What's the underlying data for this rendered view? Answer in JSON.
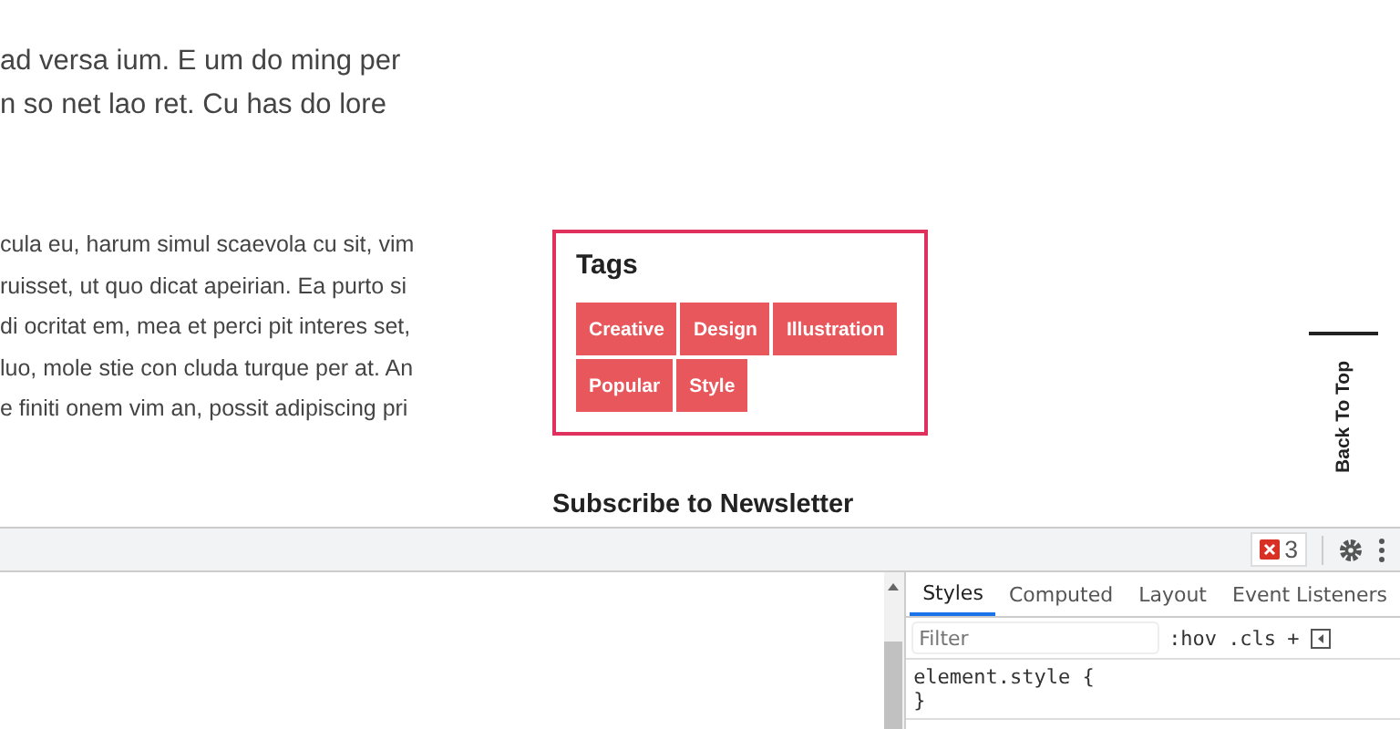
{
  "article": {
    "intro_lines": [
      "ad versa ium. E um do ming per",
      "n so net lao ret. Cu has do lore"
    ],
    "body_lines": [
      "cula eu, harum simul scaevola cu sit, vim",
      "ruisset, ut quo dicat apeirian. Ea purto si",
      "di ocritat em, mea et perci pit interes set,",
      "luo, mole stie con cluda turque per at. An",
      "e finiti onem vim an, possit adipiscing pri"
    ]
  },
  "tags_widget": {
    "title": "Tags",
    "tags": [
      "Creative",
      "Design",
      "Illustration",
      "Popular",
      "Style"
    ]
  },
  "newsletter": {
    "title": "Subscribe to Newsletter"
  },
  "back_to_top": "Back To Top",
  "devtools": {
    "error_count": "3",
    "tabs": [
      {
        "label": "Styles",
        "selected": true
      },
      {
        "label": "Computed",
        "selected": false
      },
      {
        "label": "Layout",
        "selected": false
      },
      {
        "label": "Event Listeners",
        "selected": false
      }
    ],
    "filter": {
      "placeholder": "Filter"
    },
    "toggles": [
      ":hov",
      ".cls",
      "+"
    ],
    "rule_lines": [
      "element.style {",
      "}"
    ]
  }
}
